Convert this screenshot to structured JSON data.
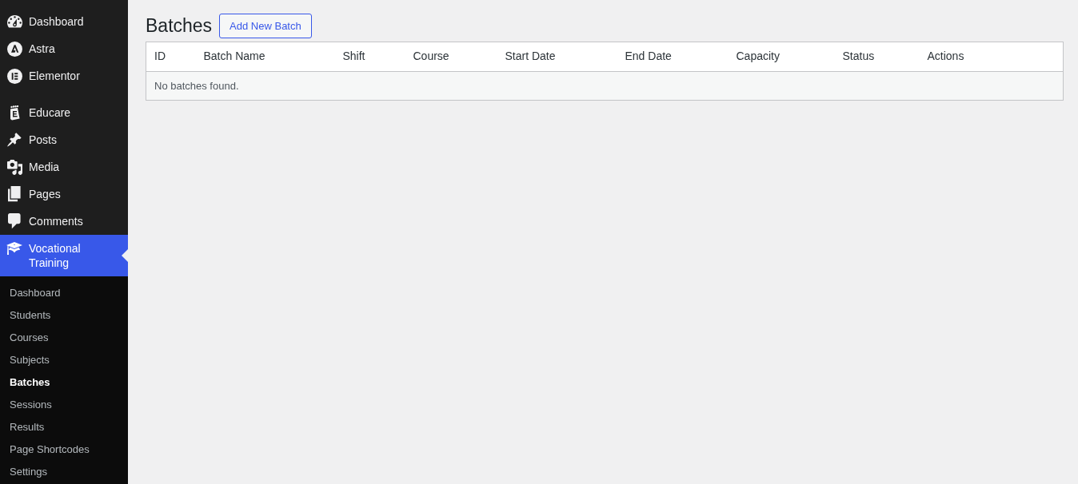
{
  "sidebar": {
    "menu_groups": [
      {
        "items": [
          {
            "label": "Dashboard",
            "selected": false
          },
          {
            "label": "Astra",
            "selected": false
          },
          {
            "label": "Elementor",
            "selected": false
          }
        ]
      },
      {
        "items": [
          {
            "label": "Educare",
            "selected": false
          },
          {
            "label": "Posts",
            "selected": false
          },
          {
            "label": "Media",
            "selected": false
          },
          {
            "label": "Pages",
            "selected": false
          },
          {
            "label": "Comments",
            "selected": false
          },
          {
            "label": "Vocational Training",
            "selected": true,
            "submenu": [
              {
                "label": "Dashboard",
                "selected": false
              },
              {
                "label": "Students",
                "selected": false
              },
              {
                "label": "Courses",
                "selected": false
              },
              {
                "label": "Subjects",
                "selected": false
              },
              {
                "label": "Batches",
                "selected": true
              },
              {
                "label": "Sessions",
                "selected": false
              },
              {
                "label": "Results",
                "selected": false
              },
              {
                "label": "Page Shortcodes",
                "selected": false
              },
              {
                "label": "Settings",
                "selected": false
              }
            ]
          }
        ]
      }
    ]
  },
  "page": {
    "title": "Batches",
    "add_button": "Add New Batch"
  },
  "table": {
    "columns": [
      "ID",
      "Batch Name",
      "Shift",
      "Course",
      "Start Date",
      "End Date",
      "Capacity",
      "Status",
      "Actions"
    ],
    "empty_message": "No batches found."
  }
}
